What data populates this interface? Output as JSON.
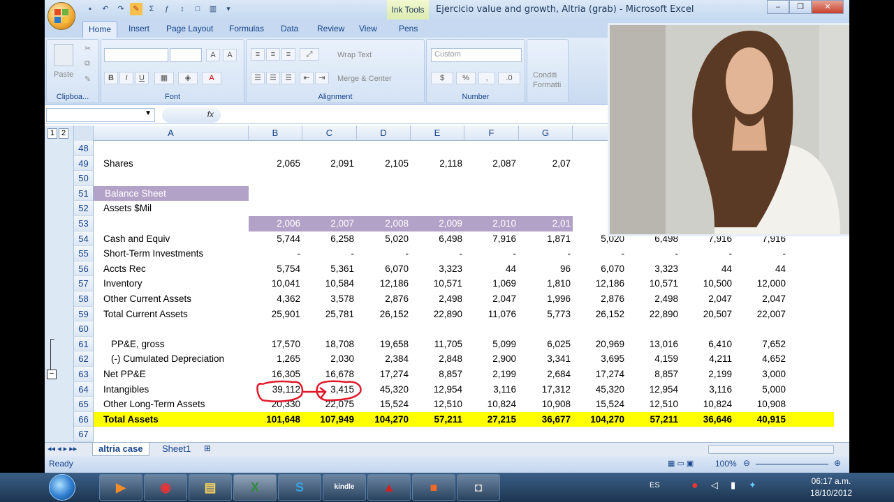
{
  "window": {
    "title": "Ejercicio value and growth, Altria (grab) - Microsoft Excel",
    "context_tab": "Ink Tools",
    "tabs": [
      "Home",
      "Insert",
      "Page Layout",
      "Formulas",
      "Data",
      "Review",
      "View",
      "Pens"
    ]
  },
  "ribbon": {
    "clipboard": {
      "paste": "Paste",
      "label": "Clipboa..."
    },
    "font": {
      "label": "Font",
      "bold": "B",
      "italic": "I",
      "underline": "U"
    },
    "alignment": {
      "label": "Alignment",
      "wrap": "Wrap Text",
      "merge": "Merge & Center"
    },
    "number": {
      "label": "Number",
      "format": "Custom",
      "percent": "%"
    },
    "styles": {
      "cond": "Conditi Formatti"
    }
  },
  "formula_bar": {
    "fx": "fx"
  },
  "outline_levels": [
    "1",
    "2"
  ],
  "columns": [
    "A",
    "B",
    "C",
    "D",
    "E",
    "F",
    "G"
  ],
  "rows": [
    {
      "n": "48",
      "label": "",
      "values": []
    },
    {
      "n": "49",
      "label": "Shares",
      "values": [
        "2,065",
        "2,091",
        "2,105",
        "2,118",
        "2,087",
        "2,07"
      ]
    },
    {
      "n": "50",
      "label": "",
      "values": []
    },
    {
      "n": "51",
      "label": "Balance Sheet",
      "style": "purple-label",
      "values": []
    },
    {
      "n": "52",
      "label": "Assets $Mil",
      "values": []
    },
    {
      "n": "53",
      "label": "",
      "style": "purple-values",
      "values": [
        "2,006",
        "2,007",
        "2,008",
        "2,009",
        "2,010",
        "2,01"
      ]
    },
    {
      "n": "54",
      "label": "Cash and Equiv",
      "values": [
        "5,744",
        "6,258",
        "5,020",
        "6,498",
        "7,916",
        "1,871",
        "5,020",
        "6,498",
        "7,916",
        "7,916"
      ]
    },
    {
      "n": "55",
      "label": "Short-Term Investments",
      "values": [
        "-",
        "-",
        "-",
        "-",
        "-",
        "-",
        "-",
        "-",
        "-",
        "-"
      ]
    },
    {
      "n": "56",
      "label": "Accts Rec",
      "values": [
        "5,754",
        "5,361",
        "6,070",
        "3,323",
        "44",
        "96",
        "6,070",
        "3,323",
        "44",
        "44"
      ]
    },
    {
      "n": "57",
      "label": "Inventory",
      "values": [
        "10,041",
        "10,584",
        "12,186",
        "10,571",
        "1,069",
        "1,810",
        "12,186",
        "10,571",
        "10,500",
        "12,000"
      ]
    },
    {
      "n": "58",
      "label": "Other Current Assets",
      "values": [
        "4,362",
        "3,578",
        "2,876",
        "2,498",
        "2,047",
        "1,996",
        "2,876",
        "2,498",
        "2,047",
        "2,047"
      ]
    },
    {
      "n": "59",
      "label": "Total Current Assets",
      "values": [
        "25,901",
        "25,781",
        "26,152",
        "22,890",
        "11,076",
        "5,773",
        "26,152",
        "22,890",
        "20,507",
        "22,007"
      ]
    },
    {
      "n": "60",
      "label": "",
      "values": []
    },
    {
      "n": "61",
      "label": "PP&E, gross",
      "indent": true,
      "values": [
        "17,570",
        "18,708",
        "19,658",
        "11,705",
        "5,099",
        "6,025",
        "20,969",
        "13,016",
        "6,410",
        "7,652"
      ]
    },
    {
      "n": "62",
      "label": "(-) Cumulated Depreciation",
      "indent": true,
      "values": [
        "1,265",
        "2,030",
        "2,384",
        "2,848",
        "2,900",
        "3,341",
        "3,695",
        "4,159",
        "4,211",
        "4,652"
      ]
    },
    {
      "n": "63",
      "label": "Net PP&E",
      "values": [
        "16,305",
        "16,678",
        "17,274",
        "8,857",
        "2,199",
        "2,684",
        "17,274",
        "8,857",
        "2,199",
        "3,000"
      ]
    },
    {
      "n": "64",
      "label": "Intangibles",
      "values": [
        "39,112",
        "3,415",
        "45,320",
        "12,954",
        "3,116",
        "17,312",
        "45,320",
        "12,954",
        "3,116",
        "5,000"
      ]
    },
    {
      "n": "65",
      "label": "Other Long-Term Assets",
      "values": [
        "20,330",
        "22,075",
        "15,524",
        "12,510",
        "10,824",
        "10,908",
        "15,524",
        "12,510",
        "10,824",
        "10,908"
      ]
    },
    {
      "n": "66",
      "label": "Total Assets",
      "style": "yellow",
      "values": [
        "101,648",
        "107,949",
        "104,270",
        "57,211",
        "27,215",
        "36,677",
        "104,270",
        "57,211",
        "36,646",
        "40,915"
      ]
    },
    {
      "n": "67",
      "label": "",
      "values": []
    }
  ],
  "sheet_tabs": [
    "altria case",
    "Sheet1"
  ],
  "status": {
    "text": "Ready",
    "zoom": "100%"
  },
  "taskbar": {
    "lang": "ES",
    "time": "06:17 a.m.",
    "date": "18/10/2012",
    "kindle": "kindle"
  },
  "colors": {
    "purple": "#b3a2c7",
    "yellow": "#ffff00",
    "ink": "#e0192b"
  }
}
